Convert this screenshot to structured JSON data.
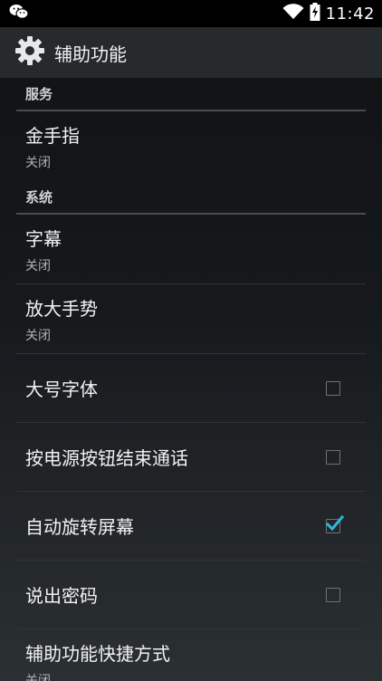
{
  "status_bar": {
    "time": "11:42",
    "icons": [
      "wechat-icon",
      "wifi-icon",
      "battery-charging-icon"
    ]
  },
  "action_bar": {
    "title": "辅助功能",
    "icon": "settings-gear-icon"
  },
  "sections": [
    {
      "header": "服务",
      "items": [
        {
          "title": "金手指",
          "summary": "关闭"
        }
      ]
    },
    {
      "header": "系统",
      "items": [
        {
          "title": "字幕",
          "summary": "关闭"
        },
        {
          "title": "放大手势",
          "summary": "关闭"
        },
        {
          "title": "大号字体",
          "checked": false
        },
        {
          "title": "按电源按钮结束通话",
          "checked": false
        },
        {
          "title": "自动旋转屏幕",
          "checked": true
        },
        {
          "title": "说出密码",
          "checked": false
        },
        {
          "title": "辅助功能快捷方式",
          "summary": "关闭"
        }
      ]
    }
  ],
  "colors": {
    "accent": "#33b5e5",
    "background": "#101214",
    "action_bar": "#262a2d"
  }
}
